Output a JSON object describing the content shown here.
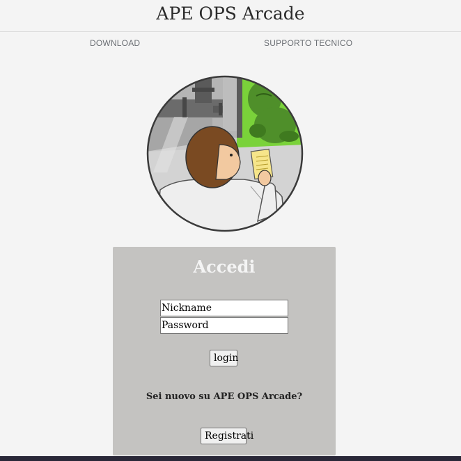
{
  "header": {
    "title": "APE OPS Arcade"
  },
  "nav": {
    "download": "DOWNLOAD",
    "support": "SUPPORTO TECNICO"
  },
  "login": {
    "title": "Accedi",
    "nickname_placeholder": "Nickname",
    "password_placeholder": "Password",
    "login_label": "login",
    "signup_prompt": "Sei nuovo su APE OPS Arcade?",
    "register_label": "Registrati"
  },
  "colors": {
    "background": "#f4f4f4",
    "panel": "#c4c3c1",
    "footer": "#2a2838",
    "ape_green": "#7ad23a"
  }
}
